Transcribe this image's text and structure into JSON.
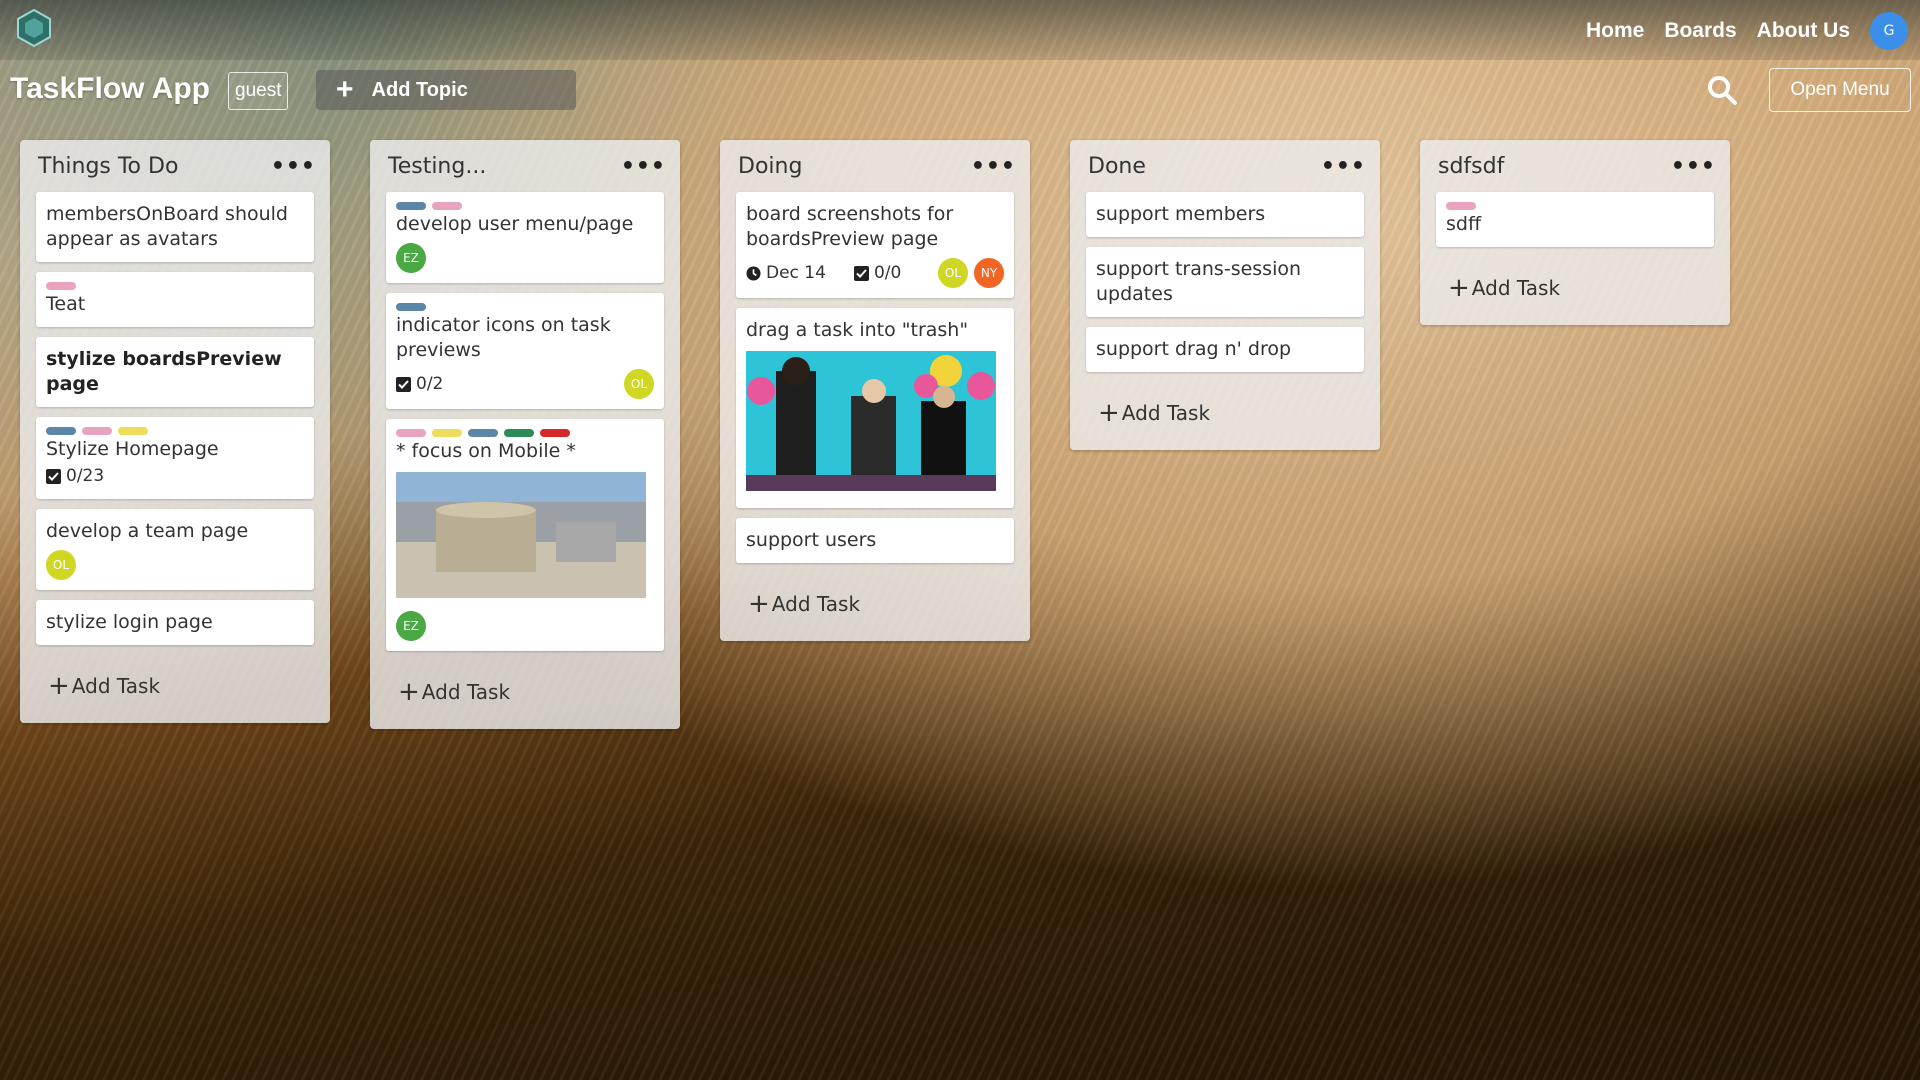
{
  "nav": {
    "home": "Home",
    "boards": "Boards",
    "about": "About Us",
    "user_initial": "G"
  },
  "toolbar": {
    "app_title": "TaskFlow App",
    "user_label": "guest",
    "add_topic_label": "Add Topic",
    "open_menu_label": "Open Menu"
  },
  "colors": {
    "accent_blue": "#3b8fe8",
    "label_blue": "#5b86a8",
    "label_pink": "#e8a3c0",
    "label_yellow": "#eedd5a",
    "label_green": "#2e8b57",
    "label_red": "#d62828",
    "avatar_green": "#4aa845",
    "avatar_lime": "#cfd722",
    "avatar_orange": "#f26522"
  },
  "lists": [
    {
      "title": "Things To Do",
      "add_task": "Add Task",
      "cards": [
        {
          "text": "membersOnBoard should appear as avatars"
        },
        {
          "text": "Teat"
        },
        {
          "text": "stylize boardsPreview page"
        },
        {
          "text": "Stylize Homepage",
          "checklist": "0/23"
        },
        {
          "text": "develop a team page",
          "avatar": "OL"
        },
        {
          "text": "stylize login page"
        }
      ]
    },
    {
      "title": "Testing...",
      "add_task": "Add Task",
      "cards": [
        {
          "text": "develop user menu/page",
          "avatar": "EZ"
        },
        {
          "text": "indicator icons on task previews",
          "checklist": "0/2",
          "avatar": "OL"
        },
        {
          "text": "* focus on Mobile *",
          "avatar": "EZ"
        }
      ]
    },
    {
      "title": "Doing",
      "add_task": "Add Task",
      "cards": [
        {
          "text": "board screenshots for boardsPreview page",
          "date": "Dec 14",
          "checklist": "0/0",
          "avatars": [
            "OL",
            "NY"
          ]
        },
        {
          "text": "drag a task into \"trash\""
        },
        {
          "text": "support users"
        }
      ]
    },
    {
      "title": "Done",
      "add_task": "Add Task",
      "cards": [
        {
          "text": "support members"
        },
        {
          "text": "support trans-session updates"
        },
        {
          "text": "support drag n' drop"
        }
      ]
    },
    {
      "title": "sdfsdf",
      "add_task": "Add Task",
      "cards": [
        {
          "text": "sdff"
        }
      ]
    }
  ]
}
